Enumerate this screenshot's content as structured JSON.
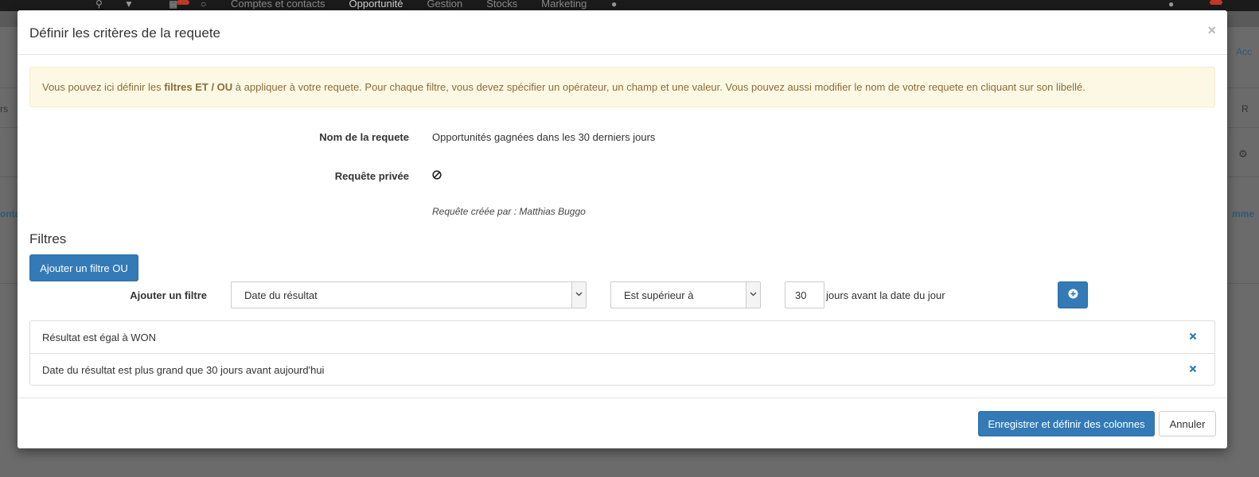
{
  "background": {
    "nav": [
      "Comptes et contacts",
      "Opportunité",
      "Gestion",
      "Stocks",
      "Marketing"
    ],
    "active_nav": "Opportunité",
    "side_left_1": "rs",
    "side_left_2": "onta",
    "side_right_1": "Acc",
    "side_right_2": "R",
    "side_right_3": "mme"
  },
  "modal": {
    "title": "Définir les critères de la requete",
    "close_glyph": "×",
    "alert": {
      "part1": "Vous pouvez ici définir les ",
      "bold": "filtres ET / OU",
      "part2": " à appliquer à votre requete. Pour chaque filtre, vous devez spécifier un opérateur, un champ et une valeur. Vous pouvez aussi modifier le nom de votre requete en cliquant sur son libellé."
    },
    "query_name_label": "Nom de la requete",
    "query_name_value": "Opportunités gagnées dans les 30 derniers jours",
    "private_label": "Requête privée",
    "created_by": "Requête créée par : Matthias Buggo",
    "filters_title": "Filtres",
    "add_or_filter_button": "Ajouter un filtre OU",
    "add_filter_label": "Ajouter un filtre",
    "field_select_value": "Date du résultat",
    "operator_select_value": "Est supérieur à",
    "value_input": "30",
    "value_suffix": "jours avant la date du jour",
    "filters": [
      "Résultat est égal à WON",
      "Date du résultat est plus grand que 30 jours avant aujourd'hui"
    ],
    "save_button": "Enregistrer et définir des colonnes",
    "cancel_button": "Annuler"
  },
  "colors": {
    "primary": "#337ab7",
    "alert_bg": "#fcf8e3",
    "alert_text": "#8a6d3b"
  }
}
